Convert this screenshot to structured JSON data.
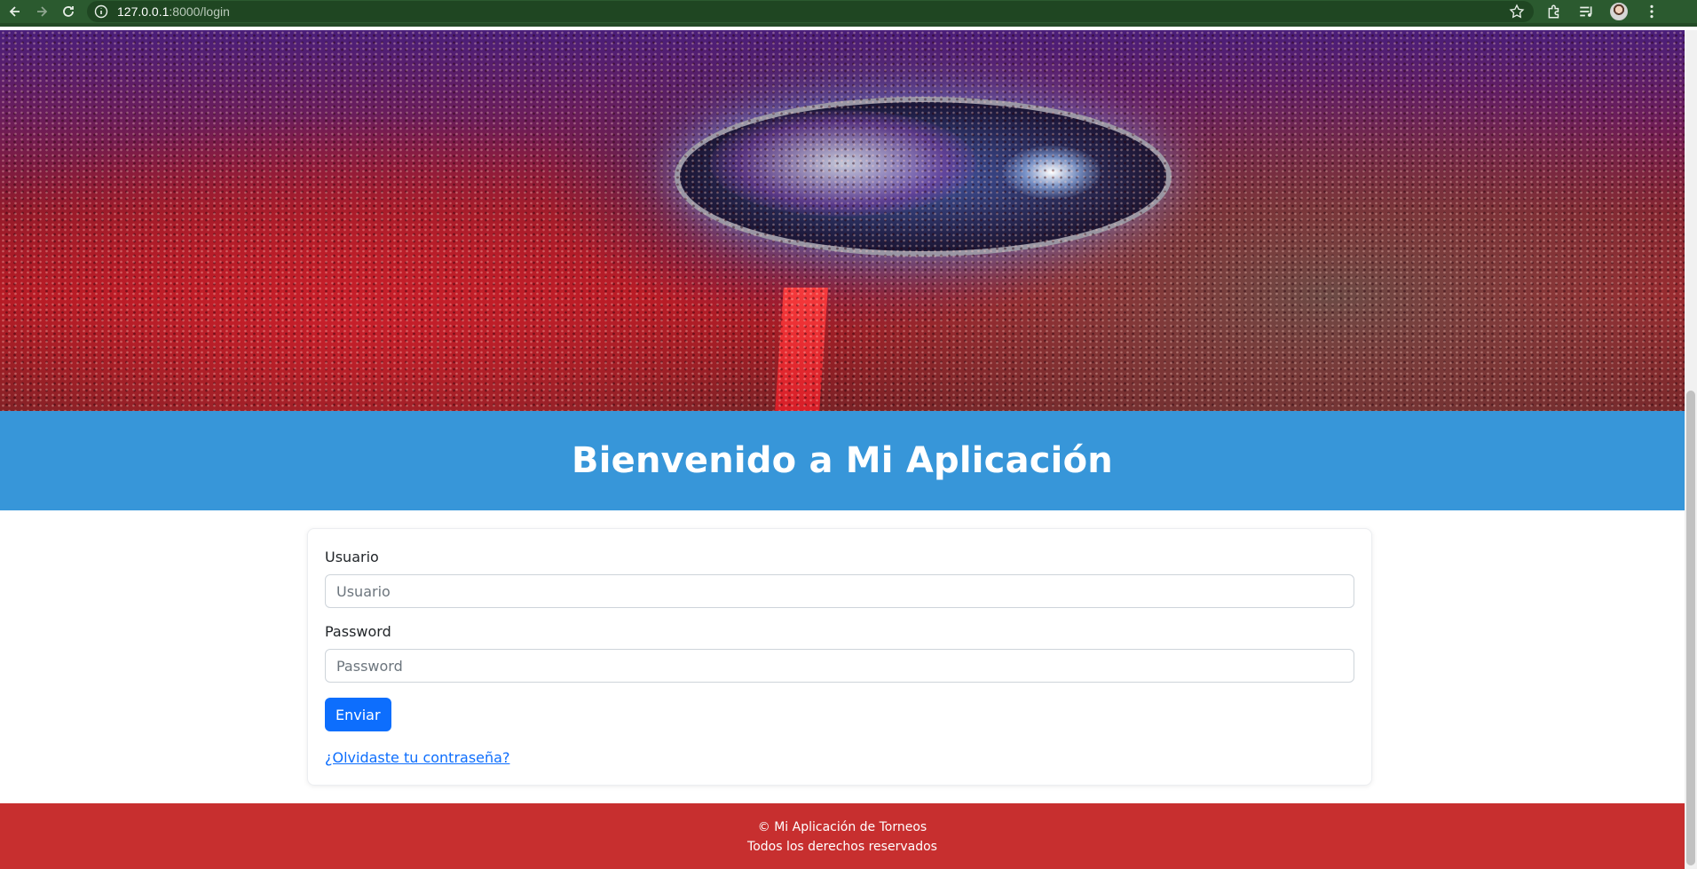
{
  "browser": {
    "url_host": "127.0.0.1",
    "url_path": ":8000/login",
    "icons": [
      "back-icon",
      "forward-icon",
      "reload-icon",
      "site-info-icon",
      "star-icon",
      "extensions-icon",
      "media-icon",
      "profile-avatar",
      "menu-icon"
    ]
  },
  "hero": {
    "image": "esports-arena-crowd"
  },
  "header": {
    "title": "Bienvenido a Mi Aplicación",
    "background": "#3796d9"
  },
  "form": {
    "username_label": "Usuario",
    "username_placeholder": "Usuario",
    "password_label": "Password",
    "password_placeholder": "Password",
    "submit_label": "Enviar",
    "forgot_link": "¿Olvidaste tu contraseña?",
    "accent": "#0d6efd"
  },
  "footer": {
    "line1": "© Mi Aplicación de Torneos",
    "line2": "Todos los derechos reservados",
    "background": "#c72f2f"
  }
}
